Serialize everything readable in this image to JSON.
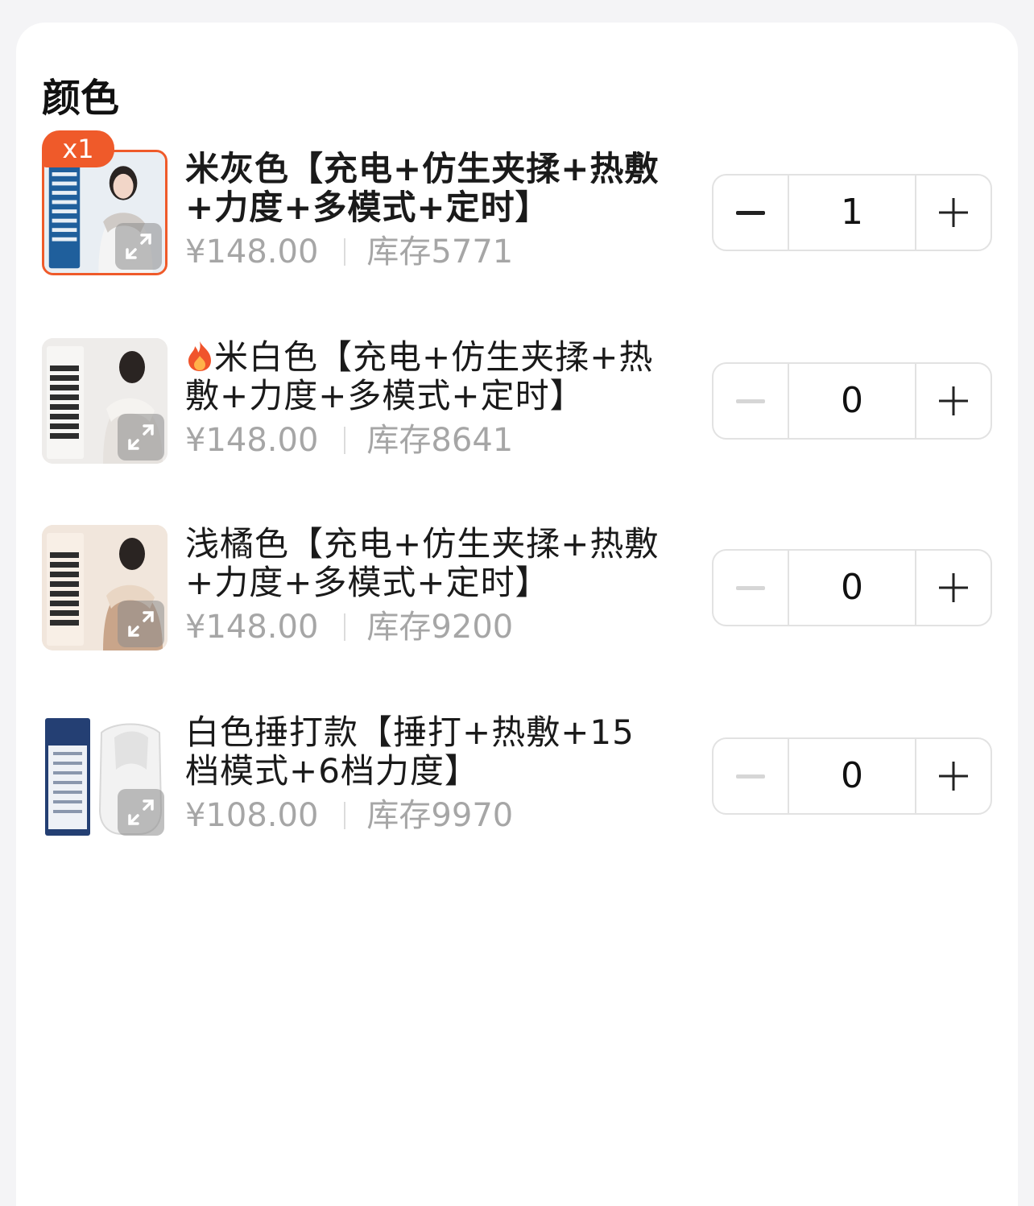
{
  "section": {
    "title": "颜色"
  },
  "colors": {
    "accent": "#ef5a2a",
    "muted": "#a6a6a6",
    "border": "#e2e2e2"
  },
  "items": [
    {
      "badge": "x1",
      "name": "米灰色【充电+仿生夹揉+热敷+力度+多模式+定时】",
      "price": "¥148.00",
      "stock": "库存5771",
      "quantity": "1",
      "selected": true
    },
    {
      "name": "米白色【充电+仿生夹揉+热敷+力度+多模式+定时】",
      "hot_icon": "fire-icon",
      "price": "¥148.00",
      "stock": "库存8641",
      "quantity": "0",
      "selected": false
    },
    {
      "name": "浅橘色【充电+仿生夹揉+热敷+力度+多模式+定时】",
      "price": "¥148.00",
      "stock": "库存9200",
      "quantity": "0",
      "selected": false
    },
    {
      "name": "白色捶打款【捶打+热敷+15档模式+6档力度】",
      "price": "¥108.00",
      "stock": "库存9970",
      "quantity": "0",
      "selected": false
    }
  ]
}
